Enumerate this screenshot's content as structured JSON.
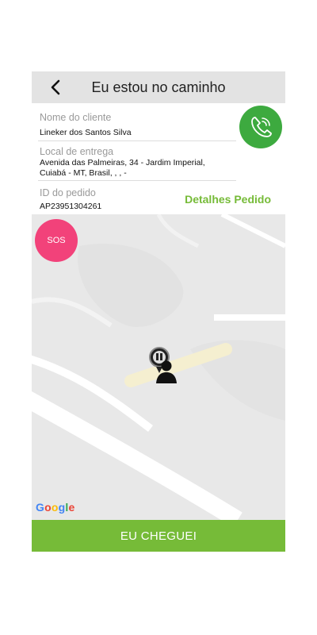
{
  "header": {
    "title": "Eu estou no caminho"
  },
  "customer": {
    "label": "Nome do cliente",
    "name": "Lineker dos Santos Silva"
  },
  "delivery": {
    "label": "Local de entrega",
    "address_line1": "Avenida das Palmeiras, 34 - Jardim Imperial,",
    "address_line2": "Cuiabá - MT, Brasil, , , -"
  },
  "order": {
    "label": "ID do pedido",
    "id": "AP23951304261",
    "details_link": "Detalhes Pedido"
  },
  "sos_button": {
    "label": "SOS"
  },
  "map": {
    "attribution": "Google"
  },
  "arrive_button": {
    "label": "EU CHEGUEI"
  },
  "colors": {
    "accent_green": "#76bb38",
    "call_green": "#3daa3f",
    "sos_pink": "#f2427a"
  },
  "icons": [
    "back-arrow-icon",
    "phone-call-icon",
    "driver-pin-icon",
    "user-location-icon"
  ]
}
